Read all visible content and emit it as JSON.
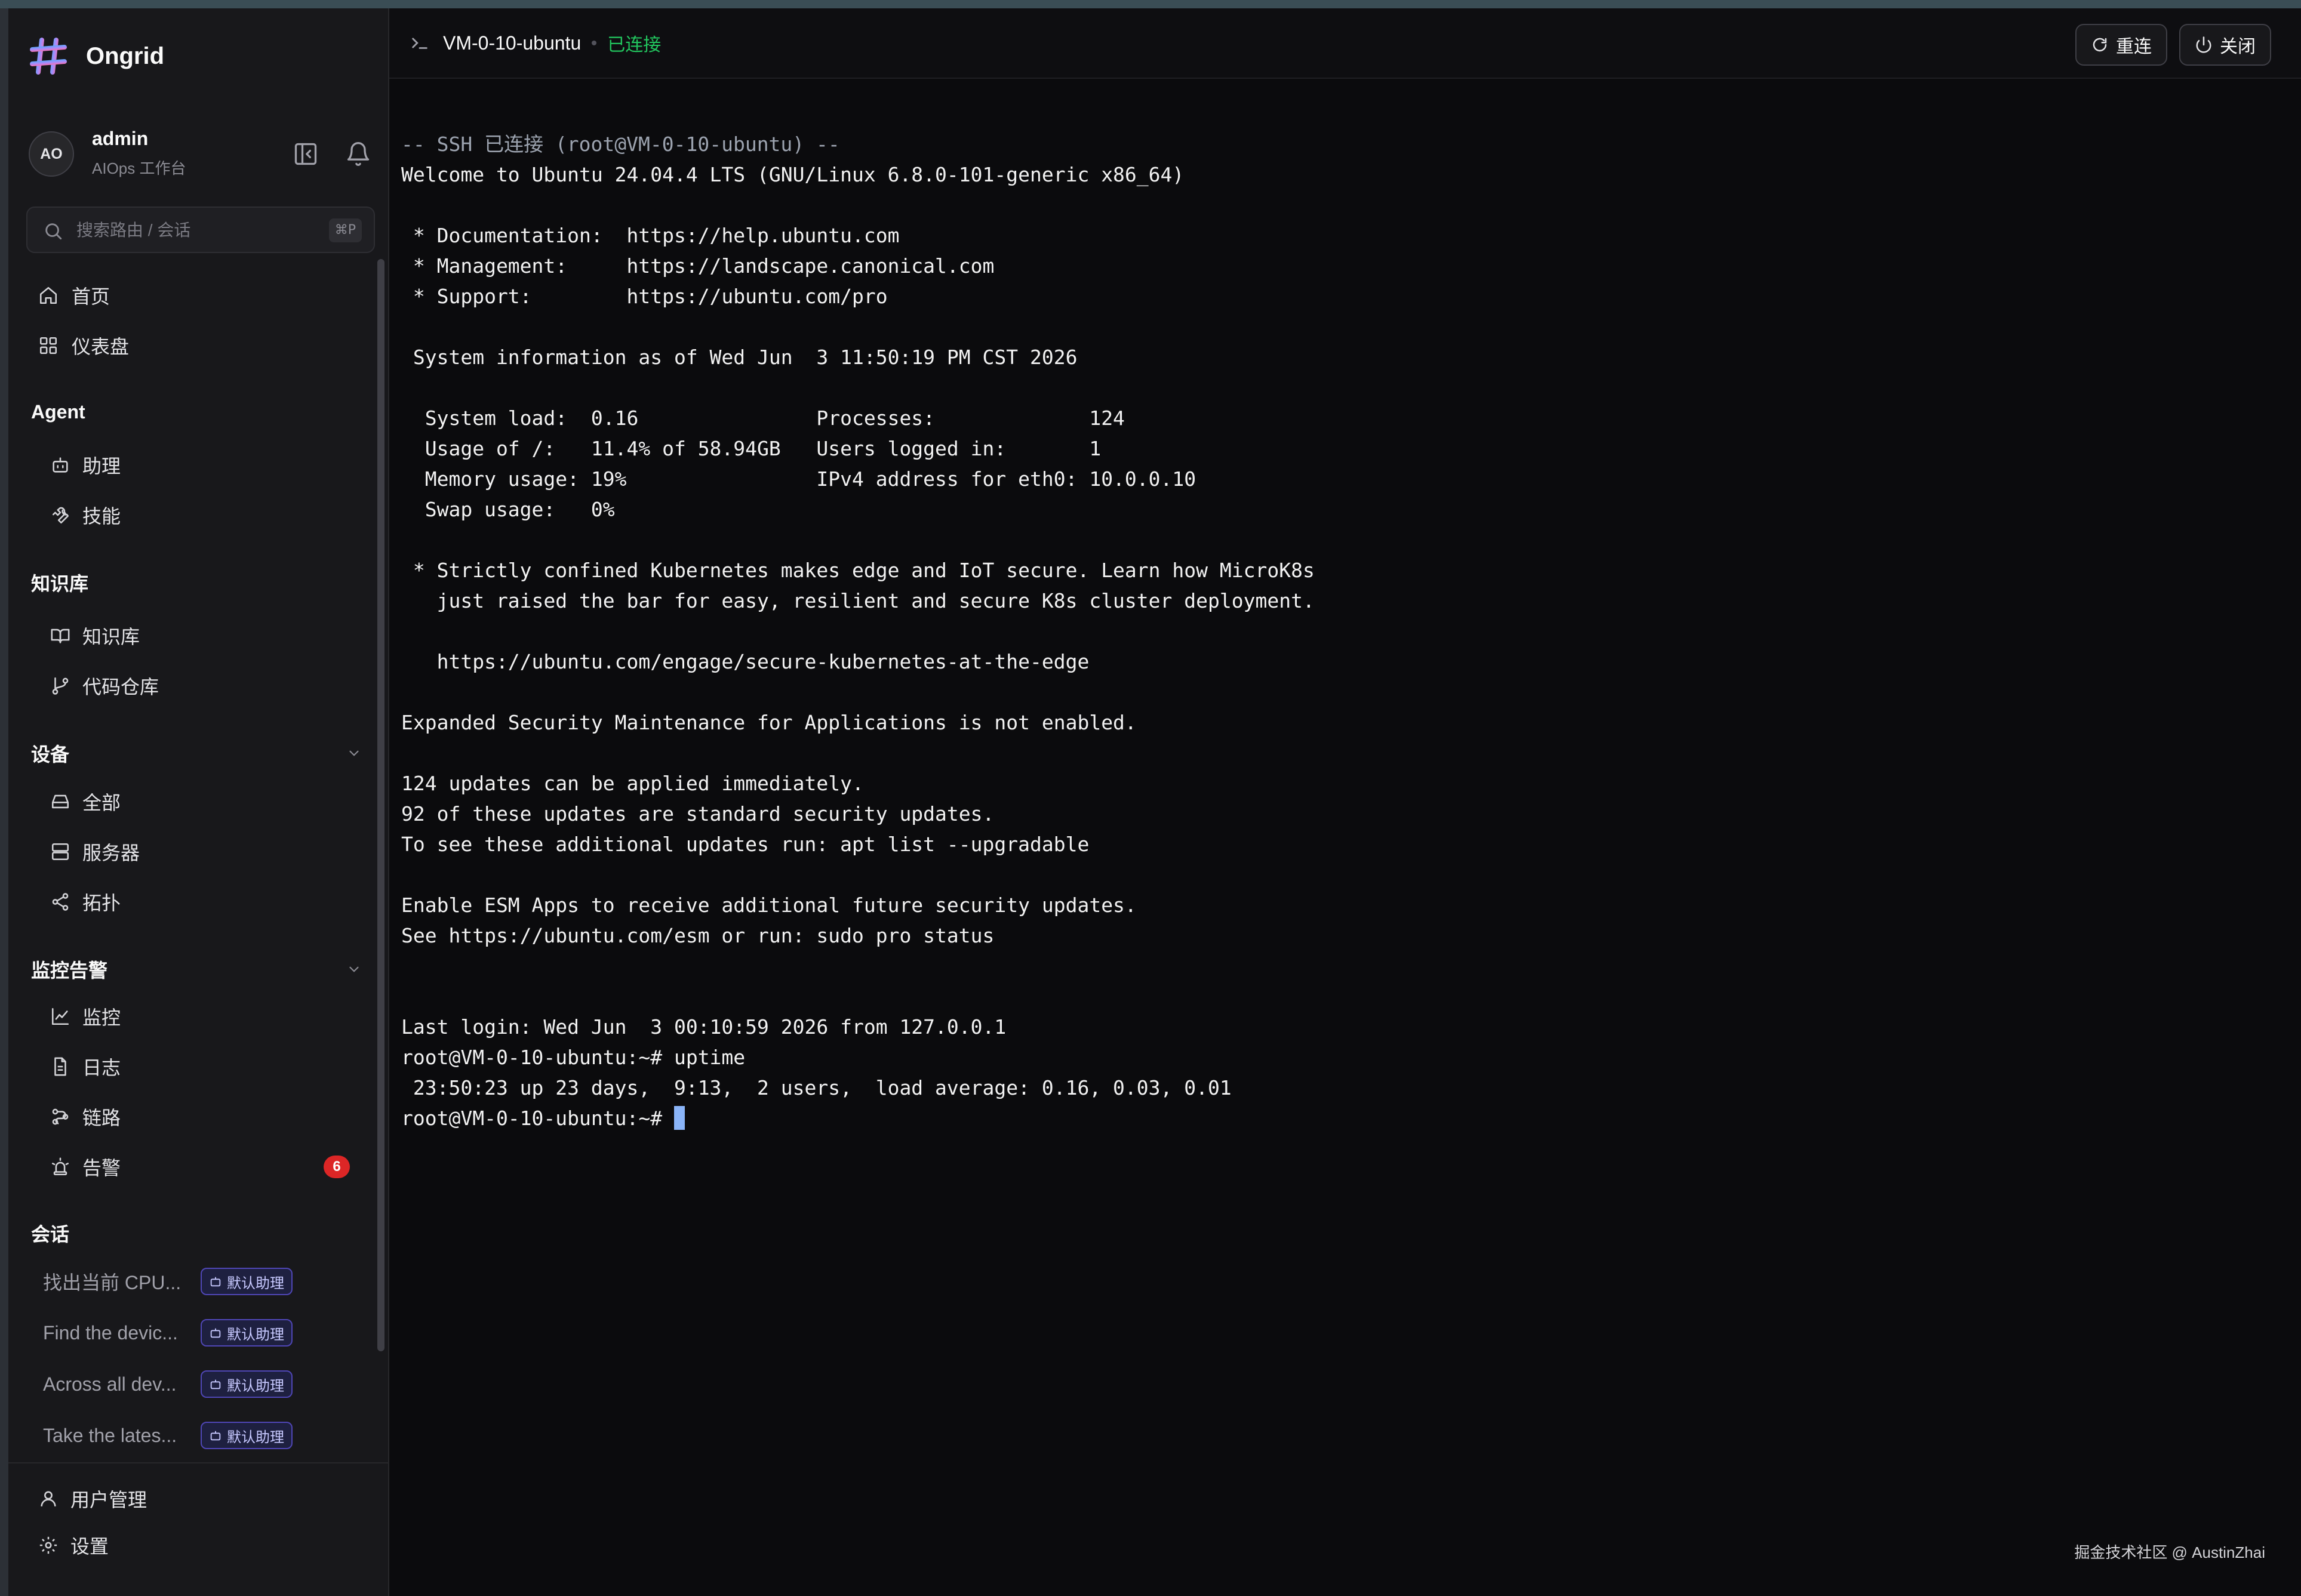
{
  "app": {
    "name": "Ongrid"
  },
  "user": {
    "name": "admin",
    "subtitle": "AIOps 工作台",
    "initials": "AO"
  },
  "search": {
    "placeholder": "搜索路由 / 会话",
    "shortcut": "⌘P"
  },
  "nav": {
    "home": "首页",
    "dashboard": "仪表盘",
    "agent": {
      "title": "Agent",
      "items": [
        "助理",
        "技能"
      ]
    },
    "knowledge": {
      "title": "知识库",
      "items": [
        "知识库",
        "代码仓库"
      ]
    },
    "devices": {
      "title": "设备",
      "items": [
        "全部",
        "服务器",
        "拓扑"
      ]
    },
    "monitoring": {
      "title": "监控告警",
      "items": [
        "监控",
        "日志",
        "链路",
        "告警"
      ],
      "alert_count": "6"
    },
    "sessions": {
      "title": "会话",
      "items": [
        {
          "title": "找出当前 CPU...",
          "tag": "默认助理"
        },
        {
          "title": "Find the devic...",
          "tag": "默认助理"
        },
        {
          "title": "Across all dev...",
          "tag": "默认助理"
        },
        {
          "title": "Take the lates...",
          "tag": "默认助理"
        }
      ]
    },
    "footer": {
      "users": "用户管理",
      "settings": "设置"
    }
  },
  "terminal": {
    "host": "VM-0-10-ubuntu",
    "status": "已连接",
    "reconnect": "重连",
    "close": "关闭",
    "lines": [
      "-- SSH 已连接 (root@VM-0-10-ubuntu) --",
      "Welcome to Ubuntu 24.04.4 LTS (GNU/Linux 6.8.0-101-generic x86_64)",
      "",
      " * Documentation:  https://help.ubuntu.com",
      " * Management:     https://landscape.canonical.com",
      " * Support:        https://ubuntu.com/pro",
      "",
      " System information as of Wed Jun  3 11:50:19 PM CST 2026",
      "",
      "  System load:  0.16               Processes:             124",
      "  Usage of /:   11.4% of 58.94GB   Users logged in:       1",
      "  Memory usage: 19%                IPv4 address for eth0: 10.0.0.10",
      "  Swap usage:   0%",
      "",
      " * Strictly confined Kubernetes makes edge and IoT secure. Learn how MicroK8s",
      "   just raised the bar for easy, resilient and secure K8s cluster deployment.",
      "",
      "   https://ubuntu.com/engage/secure-kubernetes-at-the-edge",
      "",
      "Expanded Security Maintenance for Applications is not enabled.",
      "",
      "124 updates can be applied immediately.",
      "92 of these updates are standard security updates.",
      "To see these additional updates run: apt list --upgradable",
      "",
      "Enable ESM Apps to receive additional future security updates.",
      "See https://ubuntu.com/esm or run: sudo pro status",
      "",
      "",
      "Last login: Wed Jun  3 00:10:59 2026 from 127.0.0.1",
      "root@VM-0-10-ubuntu:~# uptime",
      " 23:50:23 up 23 days,  9:13,  2 users,  load average: 0.16, 0.03, 0.01"
    ],
    "prompt": "root@VM-0-10-ubuntu:~# "
  },
  "watermark": "掘金技术社区 @ AustinZhai",
  "colors": {
    "accent_green": "#22c55e",
    "badge_red": "#dc2626",
    "cursor": "#8ab4f8",
    "tag_border": "#4f46b5"
  }
}
